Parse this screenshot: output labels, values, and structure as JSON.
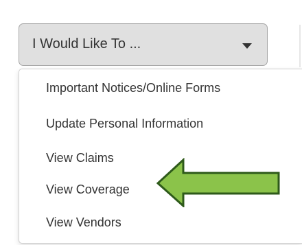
{
  "dropdown": {
    "label": "I Would Like To ...",
    "caret_icon": "caret-down-icon"
  },
  "menu": {
    "items": [
      {
        "label": "Important Notices/Online Forms"
      },
      {
        "label": "Update Personal Information"
      },
      {
        "label": "View Claims"
      },
      {
        "label": "View Coverage"
      },
      {
        "label": "View Vendors"
      }
    ]
  },
  "annotation": {
    "icon": "left-arrow-icon",
    "fill_color": "#8bc34a",
    "outline_color": "#2e5a1a"
  }
}
